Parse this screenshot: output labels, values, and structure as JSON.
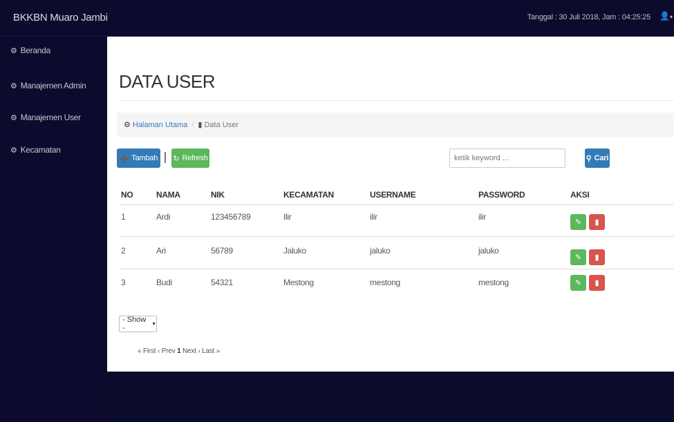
{
  "header": {
    "brand": "BKKBN Muaro Jambi",
    "datetime": "Tanggal : 30 Juli 2018, Jam : 04:25:25",
    "user_icon": "user-icon"
  },
  "sidebar": {
    "items": [
      {
        "label": "Beranda",
        "icon": "dashboard-icon"
      },
      {
        "label": "Manajemen Admin",
        "icon": "dashboard-icon"
      },
      {
        "label": "Manajemen User",
        "icon": "dashboard-icon"
      },
      {
        "label": "Kecamatan",
        "icon": "dashboard-icon"
      }
    ]
  },
  "main": {
    "title": "DATA USER",
    "breadcrumb": {
      "home": "Halaman Utama",
      "separator": "/",
      "current": "Data User"
    },
    "toolbar": {
      "add_label": "Tambah",
      "refresh_label": "Refresh"
    },
    "search": {
      "placeholder": "ketik keyword ...",
      "button_label": "Cari"
    },
    "table": {
      "headers": [
        "NO",
        "NAMA",
        "NIK",
        "KECAMATAN",
        "USERNAME",
        "PASSWORD",
        "AKSI"
      ],
      "rows": [
        [
          "1",
          "Ardi",
          "123456789",
          "Ilir",
          "ilir",
          "ilir"
        ],
        [
          "2",
          "Ari",
          "56789",
          "Jaluko",
          "jaluko",
          "jaluko"
        ],
        [
          "3",
          "Budi",
          "54321",
          "Mestong",
          "mestong",
          "mestong"
        ]
      ]
    },
    "show_select": "- Show -",
    "pagination": {
      "first": "« First",
      "prev": "‹ Prev",
      "current": "1",
      "next": "Next ›",
      "last": "Last »"
    }
  },
  "colors": {
    "sidebar_bg": "#0c0b2e",
    "primary": "#337ab7",
    "success": "#5cb85c",
    "danger": "#d9534f"
  }
}
